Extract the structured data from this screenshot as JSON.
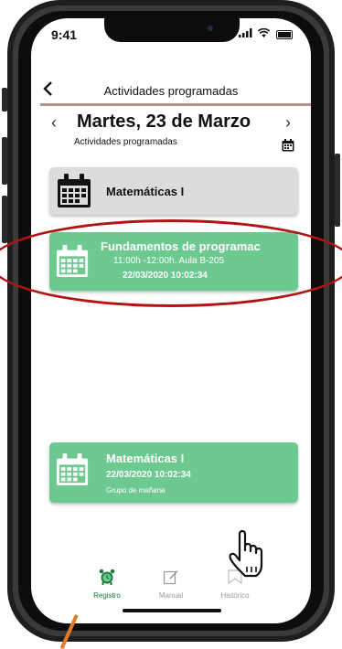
{
  "status": {
    "time": "9:41",
    "signal": "..ıl"
  },
  "header": {
    "title": "Actividades programadas",
    "back": "<"
  },
  "date": {
    "title": "Martes, 23 de Marzo",
    "subtitle": "Actividades programadas",
    "prev": "‹",
    "next": "›"
  },
  "cards": [
    {
      "title": "Matemáticas I"
    },
    {
      "title": "Fundamentos de programac",
      "line1": "11:00h -12:00h. Aula B-205",
      "line2": "22/03/2020 10:02:34"
    },
    {
      "title": "Matemáticas I",
      "line1": "22/03/2020 10:02:34",
      "line2": "Grupo de mañana"
    }
  ],
  "tabs": [
    {
      "label": "Registro"
    },
    {
      "label": "Manual"
    },
    {
      "label": "Histórico"
    }
  ],
  "colors": {
    "accent_green": "#6dc990",
    "tab_active": "#1a7a3a",
    "highlight_ellipse": "#b21414",
    "header_line": "#b5928c",
    "pointer_line": "#e07b2c"
  }
}
